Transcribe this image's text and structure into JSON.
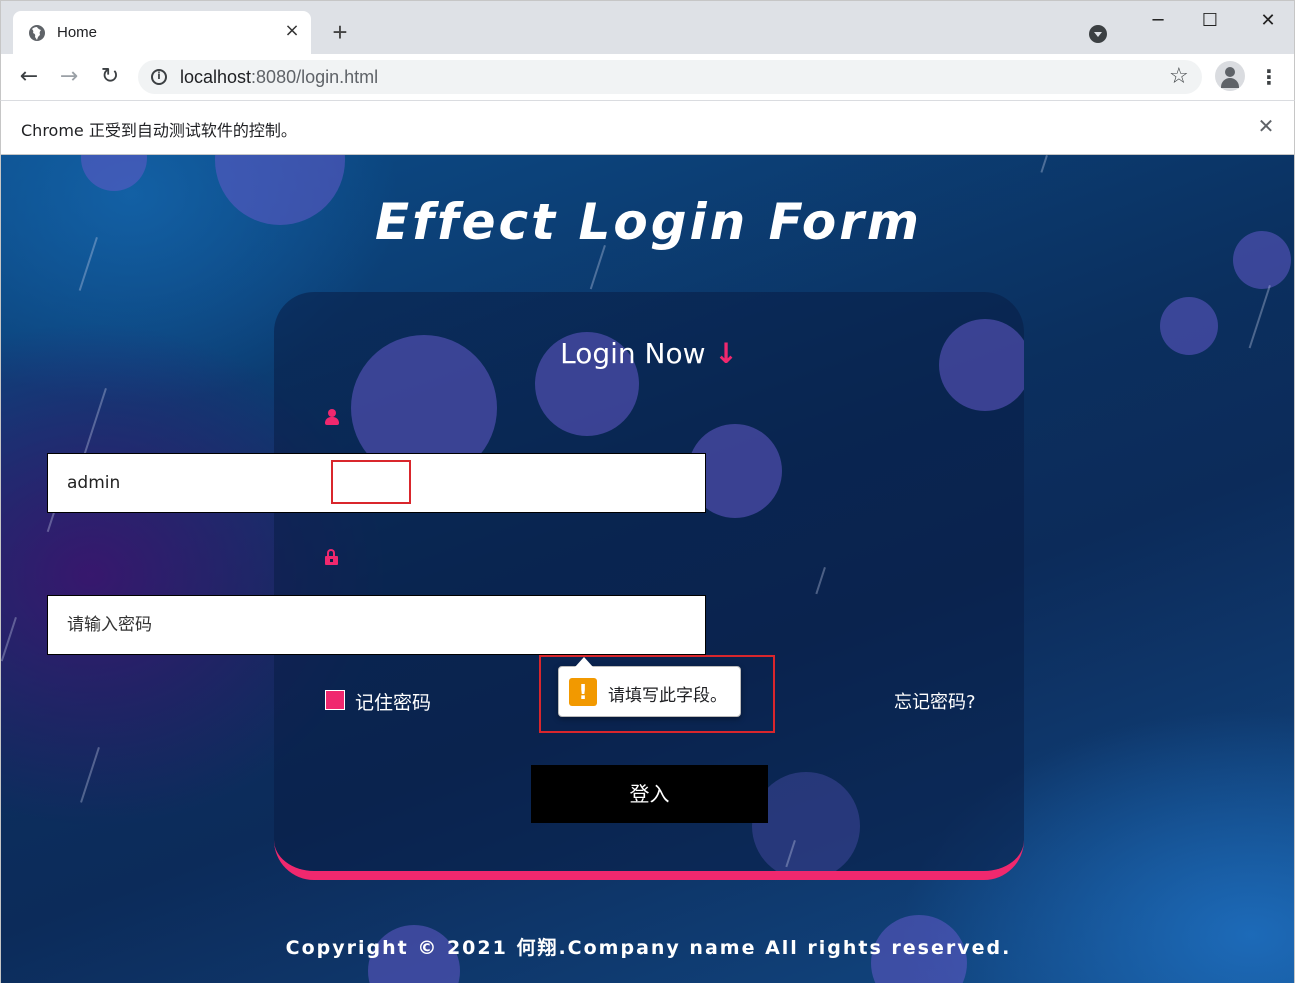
{
  "browser": {
    "tab_title": "Home",
    "tab_close": "×",
    "new_tab": "+",
    "url_host": "localhost",
    "url_rest": ":8080/login.html",
    "window_minimize": "─",
    "window_maximize": "☐",
    "window_close": "✕",
    "infobar_text": "Chrome 正受到自动测试软件的控制。",
    "infobar_close": "✕",
    "nav_back": "←",
    "nav_forward": "→",
    "nav_reload": "↻",
    "star": "☆",
    "menu": "⋮",
    "info": "i"
  },
  "page": {
    "title": "Effect Login Form",
    "card_heading": "Login Now",
    "card_heading_arrow": "↓",
    "username_value": "admin",
    "password_placeholder": "请输入密码",
    "remember_label": "记住密码",
    "forgot_label": "忘记密码?",
    "login_button": "登入",
    "tooltip_text": "请填写此字段。",
    "tooltip_icon": "!",
    "footer": "Copyright © 2021 何翔.Company name All rights reserved.",
    "accent_color": "#f0286e"
  }
}
